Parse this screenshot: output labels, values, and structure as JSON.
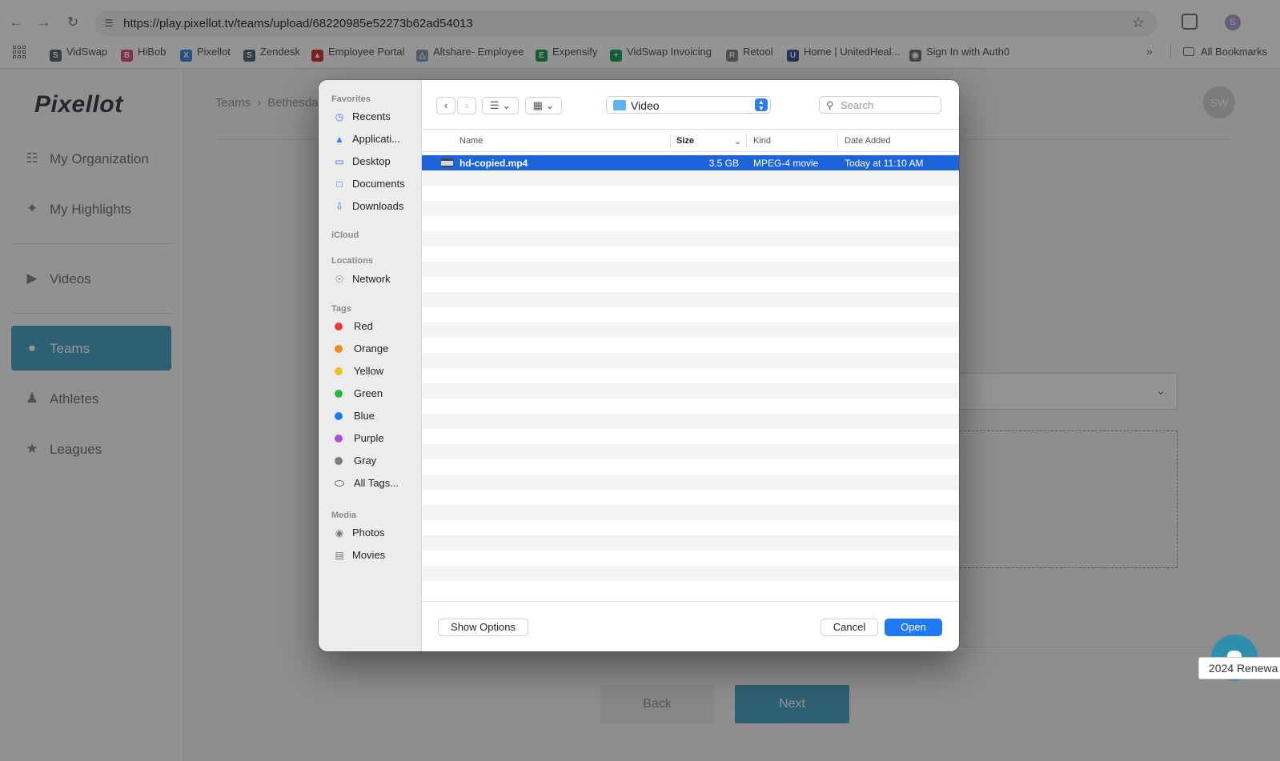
{
  "browser": {
    "url": "https://play.pixellot.tv/teams/upload/68220985e52273b62ad54013",
    "profile_initial": "S",
    "bookmarks": [
      {
        "label": "VidSwap",
        "icon": "vidswap-icon",
        "color": "#5a6b7b"
      },
      {
        "label": "HiBob",
        "icon": "hibob-icon",
        "color": "#e0567a"
      },
      {
        "label": "Pixellot",
        "icon": "pixellot-icon",
        "color": "#3a8fd9"
      },
      {
        "label": "Zendesk",
        "icon": "zendesk-icon",
        "color": "#5a6b7b"
      },
      {
        "label": "Employee Portal",
        "icon": "employee-portal-icon",
        "color": "#d33c2f"
      },
      {
        "label": "Altshare- Employee",
        "icon": "altshare-icon",
        "color": "#8aa0c0"
      },
      {
        "label": "Expensify",
        "icon": "expensify-icon",
        "color": "#21a35b"
      },
      {
        "label": "VidSwap Invoicing",
        "icon": "vidswap-invoicing-icon",
        "color": "#1fa463"
      },
      {
        "label": "Retool",
        "icon": "retool-icon",
        "color": "#888888"
      },
      {
        "label": "Home | UnitedHeal...",
        "icon": "unitedhealth-icon",
        "color": "#3b5a9a"
      },
      {
        "label": "Sign In with Auth0",
        "icon": "globe-icon",
        "color": "#777777"
      }
    ],
    "all_bookmarks": "All Bookmarks"
  },
  "app": {
    "logo": "Pixellot",
    "nav": [
      {
        "label": "My Organization",
        "icon": "organization-icon"
      },
      {
        "label": "My Highlights",
        "icon": "sparkle-icon"
      },
      {
        "label": "Videos",
        "icon": "video-icon"
      },
      {
        "label": "Teams",
        "icon": "teams-icon"
      },
      {
        "label": "Athletes",
        "icon": "athlete-icon"
      },
      {
        "label": "Leagues",
        "icon": "trophy-icon"
      }
    ],
    "breadcrumb": [
      "Teams",
      "Bethesda"
    ],
    "avatar_initials": "SW",
    "back_label": "Back",
    "next_label": "Next",
    "renewal_text": "2024 Renewa"
  },
  "dialog": {
    "sidebar": {
      "favorites_header": "Favorites",
      "favorites": [
        {
          "label": "Recents",
          "icon": "clock-icon"
        },
        {
          "label": "Applicati...",
          "icon": "applications-icon"
        },
        {
          "label": "Desktop",
          "icon": "desktop-icon"
        },
        {
          "label": "Documents",
          "icon": "document-icon"
        },
        {
          "label": "Downloads",
          "icon": "download-icon"
        }
      ],
      "icloud_header": "iCloud",
      "locations_header": "Locations",
      "locations": [
        {
          "label": "Network",
          "icon": "network-icon"
        }
      ],
      "tags_header": "Tags",
      "tags": [
        {
          "label": "Red",
          "color": "#ec3b36"
        },
        {
          "label": "Orange",
          "color": "#f28a1e"
        },
        {
          "label": "Yellow",
          "color": "#f5c01a"
        },
        {
          "label": "Green",
          "color": "#2ab73b"
        },
        {
          "label": "Blue",
          "color": "#1f7bf0"
        },
        {
          "label": "Purple",
          "color": "#a853d6"
        },
        {
          "label": "Gray",
          "color": "#7d7d7d"
        }
      ],
      "all_tags": "All Tags...",
      "media_header": "Media",
      "media": [
        {
          "label": "Photos",
          "icon": "camera-icon"
        },
        {
          "label": "Movies",
          "icon": "film-icon"
        }
      ]
    },
    "location": "Video",
    "search_placeholder": "Search",
    "columns": {
      "name": "Name",
      "size": "Size",
      "kind": "Kind",
      "date": "Date Added"
    },
    "files": [
      {
        "name": "hd-copied.mp4",
        "size": "3.5 GB",
        "kind": "MPEG-4 movie",
        "date": "Today at 11:10 AM",
        "selected": true
      }
    ],
    "show_options": "Show Options",
    "cancel": "Cancel",
    "open": "Open"
  }
}
